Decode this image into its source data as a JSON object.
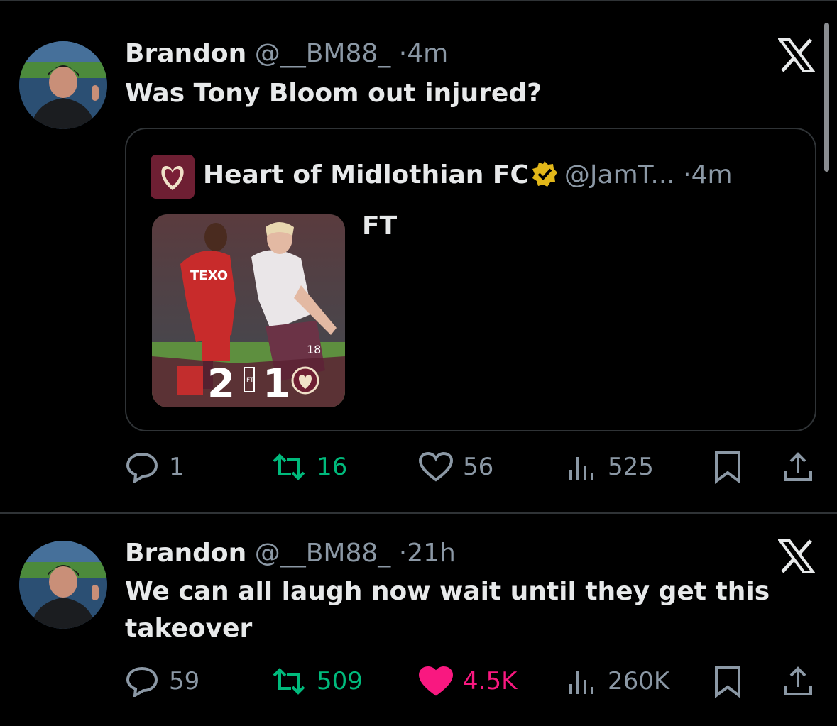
{
  "tweets": [
    {
      "author_name": "Brandon",
      "handle": "@__BM88_",
      "separator": "·",
      "time": "4m",
      "text": "Was Tony Bloom out injured?",
      "quote": {
        "author_name": "Heart of Midlothian FC",
        "handle": "@JamT...",
        "separator": "·",
        "time": "4m",
        "text": "FT",
        "media": {
          "shirt_text": "TEXO",
          "score_home": "2",
          "score_away": "1",
          "ft_label": "FT",
          "shirt_number": "18"
        }
      },
      "stats": {
        "replies": "1",
        "retweets": "16",
        "likes": "56",
        "views": "525",
        "liked": false
      }
    },
    {
      "author_name": "Brandon",
      "handle": "@__BM88_",
      "separator": "·",
      "time": "21h",
      "text": "We can all laugh now wait until they get this takeover",
      "stats": {
        "replies": "59",
        "retweets": "509",
        "likes": "4.5K",
        "views": "260K",
        "liked": true
      }
    }
  ],
  "colors": {
    "background": "#000000",
    "text": "#e7e9ea",
    "muted": "#8b98a5",
    "retweet": "#00ba7c",
    "like_active": "#f91880",
    "verified_gold": "#e2b719",
    "divider": "#2f3336"
  },
  "icons": [
    "x-logo-icon",
    "verified-badge-icon",
    "reply-icon",
    "retweet-icon",
    "heart-icon",
    "views-icon",
    "bookmark-icon",
    "share-icon"
  ]
}
